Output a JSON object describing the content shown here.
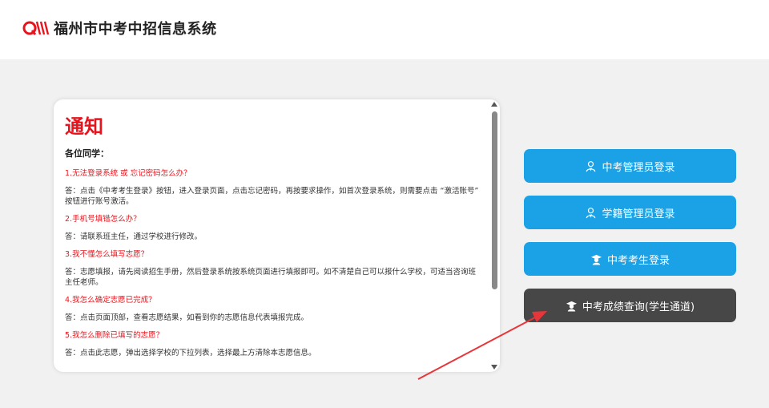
{
  "header": {
    "title": "福州市中考中招信息系统",
    "logo_icon": "brand-logo-icon"
  },
  "notice": {
    "title": "通知",
    "greeting": "各位同学：",
    "items": [
      {
        "question": "1.无法登录系统 或 忘记密码怎么办？",
        "answer": "答：点击《中考考生登录》按钮，进入登录页面，点击忘记密码，再按要求操作，如首次登录系统，则需要点击 “激活账号” 按钮进行账号激活。"
      },
      {
        "question": "2.手机号填错怎么办？",
        "answer": "答：请联系班主任，通过学校进行修改。"
      },
      {
        "question": "3.我不懂怎么填写志愿？",
        "answer": "答：志愿填报，请先阅读招生手册，然后登录系统按系统页面进行填报即可。如不清楚自己可以报什么学校，可适当咨询班主任老师。"
      },
      {
        "question": "4.我怎么确定志愿已完成？",
        "answer": "答：点击页面顶部，查看志愿结果，如看到你的志愿信息代表填报完成。"
      },
      {
        "question": "5.我怎么删除已填写的志愿？",
        "answer": "答：点击此志愿，弹出选择学校的下拉列表，选择最上方清除本志愿信息。"
      }
    ]
  },
  "buttons": {
    "admin_login": "中考管理员登录",
    "registry_login": "学籍管理员登录",
    "student_login": "中考考生登录",
    "score_query": "中考成绩查询(学生通道)"
  },
  "colors": {
    "accent_blue": "#1aa1e6",
    "dark_button": "#474747",
    "notice_red": "#e8141d",
    "annotation_arrow": "#e8353a"
  }
}
